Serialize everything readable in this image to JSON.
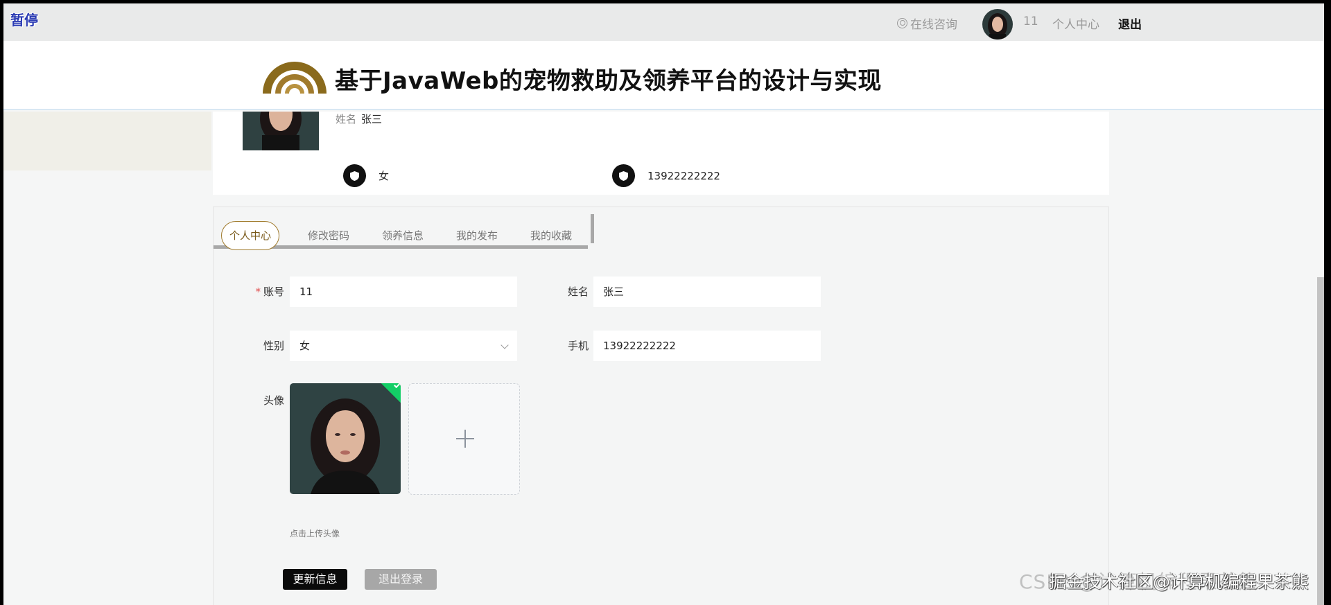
{
  "overlay": {
    "pause_label": "暂停"
  },
  "topbar": {
    "consult_label": "在线咨询",
    "username": "11",
    "center_label": "个人中心",
    "logout_label": "退出"
  },
  "header": {
    "title": "基于JavaWeb的宠物救助及领养平台的设计与实现"
  },
  "profile": {
    "name_label": "姓名",
    "name_value": "张三",
    "gender": "女",
    "phone": "13922222222"
  },
  "tabs": [
    {
      "label": "个人中心"
    },
    {
      "label": "修改密码"
    },
    {
      "label": "领养信息"
    },
    {
      "label": "我的发布"
    },
    {
      "label": "我的收藏"
    }
  ],
  "form": {
    "account_label": "账号",
    "account_value": "11",
    "name_label": "姓名",
    "name_value": "张三",
    "gender_label": "性别",
    "gender_value": "女",
    "phone_label": "手机",
    "phone_value": "13922222222",
    "avatar_label": "头像",
    "upload_tip": "点击上传头像",
    "update_button": "更新信息",
    "logout_button": "退出登录"
  },
  "watermark": {
    "text": "CSDN@计算机编程果茶熊",
    "overlay_text": "掘金技术社区@计算机编程果茶熊"
  },
  "colors": {
    "accent": "#a07a2c",
    "success": "#13ce66",
    "primary_button": "#0a0a0a"
  }
}
